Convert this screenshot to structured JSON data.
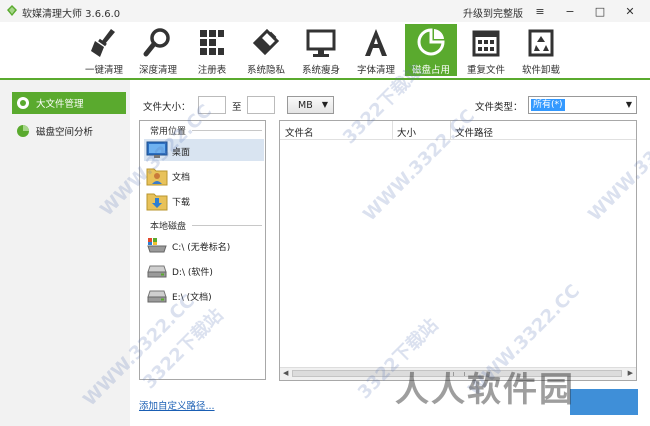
{
  "window": {
    "title": "软媒清理大师 3.6.6.0",
    "upgrade_label": "升级到完整版",
    "menu_icon": "≡",
    "minimize_icon": "−",
    "maximize_icon": "□",
    "close_icon": "✕"
  },
  "toolbar": {
    "items": [
      {
        "label": "一键清理",
        "icon": "broom-icon"
      },
      {
        "label": "深度清理",
        "icon": "magnifier-icon"
      },
      {
        "label": "注册表",
        "icon": "registry-blocks-icon"
      },
      {
        "label": "系统隐私",
        "icon": "eraser-icon"
      },
      {
        "label": "系统瘦身",
        "icon": "monitor-icon"
      },
      {
        "label": "字体清理",
        "icon": "font-a-icon"
      },
      {
        "label": "磁盘占用",
        "icon": "disk-pie-icon"
      },
      {
        "label": "重复文件",
        "icon": "calendar-grid-icon"
      },
      {
        "label": "软件卸载",
        "icon": "recycle-bin-icon"
      }
    ],
    "active_index": 6
  },
  "sidebar": {
    "items": [
      {
        "label": "大文件管理"
      },
      {
        "label": "磁盘空间分析"
      }
    ]
  },
  "filter": {
    "size_label": "文件大小：",
    "to_label": "至",
    "unit": "MB",
    "type_label": "文件类型：",
    "type_value": "所有(*)"
  },
  "tree": {
    "common_header": "常用位置",
    "local_header": "本地磁盘",
    "common_items": [
      {
        "label": "桌面"
      },
      {
        "label": "文档"
      },
      {
        "label": "下载"
      }
    ],
    "drives": [
      {
        "label": "C:\\ (无卷标名)"
      },
      {
        "label": "D:\\ (软件)"
      },
      {
        "label": "E:\\ (文档)"
      }
    ]
  },
  "file_table": {
    "columns": [
      "文件名",
      "大小",
      "文件路径"
    ]
  },
  "footer": {
    "add_path": "添加自定义路径..."
  },
  "watermark": {
    "text": "3322下载站",
    "domain": "WWW.3322.CC",
    "site": "人人软件园"
  },
  "colors": {
    "accent": "#5aaa2e",
    "selection": "#3399ff",
    "button": "#3f8fd8"
  }
}
